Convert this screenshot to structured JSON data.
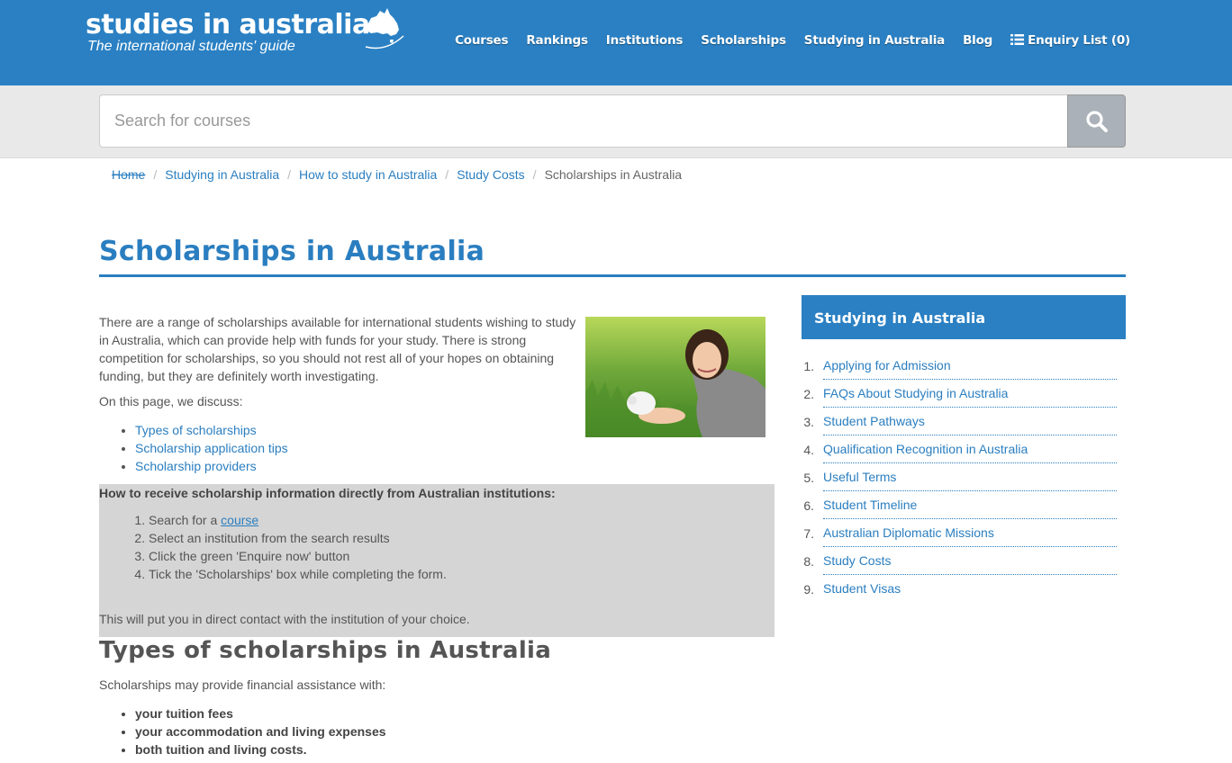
{
  "header": {
    "logo_title": "studies in australia",
    "logo_subtitle": "The international students' guide",
    "brand_color": "#2a80c3",
    "nav": [
      {
        "label": "Courses"
      },
      {
        "label": "Rankings"
      },
      {
        "label": "Institutions"
      },
      {
        "label": "Scholarships"
      },
      {
        "label": "Studying in Australia"
      },
      {
        "label": "Blog"
      },
      {
        "label": "Enquiry List (0)",
        "icon": "list-icon"
      }
    ]
  },
  "search": {
    "placeholder": "Search for courses",
    "button_icon": "search-icon"
  },
  "breadcrumb": [
    {
      "label": "Home"
    },
    {
      "label": "Studying in Australia"
    },
    {
      "label": "How to study in Australia"
    },
    {
      "label": "Study Costs"
    },
    {
      "label": "Scholarships in Australia"
    }
  ],
  "page": {
    "title": "Scholarships in Australia",
    "intro": "There are a range of scholarships available for international students wishing to study in Australia, which can provide help with funds for your study. There is strong competition for scholarships, so you should not rest all of your hopes on obtaining funding, but they are definitely worth investigating.",
    "discuss_label": "On this page, we discuss:",
    "toc": [
      "Types of scholarships",
      "Scholarship application tips",
      "Scholarship providers"
    ],
    "info_box": {
      "heading": "How to receive scholarship information directly from Australian institutions:",
      "step1_prefix": "Search for a ",
      "step1_link": "course",
      "steps": [
        "Select an institution from the search results",
        "Click the green 'Enquire now' button",
        "Tick the 'Scholarships' box while completing the form."
      ],
      "footer": "This will put you in direct contact with the institution of your choice."
    },
    "types_title": "Types of scholarships in Australia",
    "types_intro": "Scholarships may provide financial assistance with:",
    "types_list": [
      "your tuition fees",
      "your accommodation and living expenses",
      "both tuition and living costs."
    ]
  },
  "sidebar": {
    "title": "Studying in Australia",
    "items": [
      {
        "num": "1.",
        "label": "Applying for Admission"
      },
      {
        "num": "2.",
        "label": "FAQs About Studying in Australia"
      },
      {
        "num": "3.",
        "label": "Student Pathways"
      },
      {
        "num": "4.",
        "label": "Qualification Recognition in Australia"
      },
      {
        "num": "5.",
        "label": "Useful Terms"
      },
      {
        "num": "6.",
        "label": "Student Timeline"
      },
      {
        "num": "7.",
        "label": "Australian Diplomatic Missions"
      },
      {
        "num": "8.",
        "label": "Study Costs"
      },
      {
        "num": "9.",
        "label": "Student Visas"
      }
    ]
  }
}
